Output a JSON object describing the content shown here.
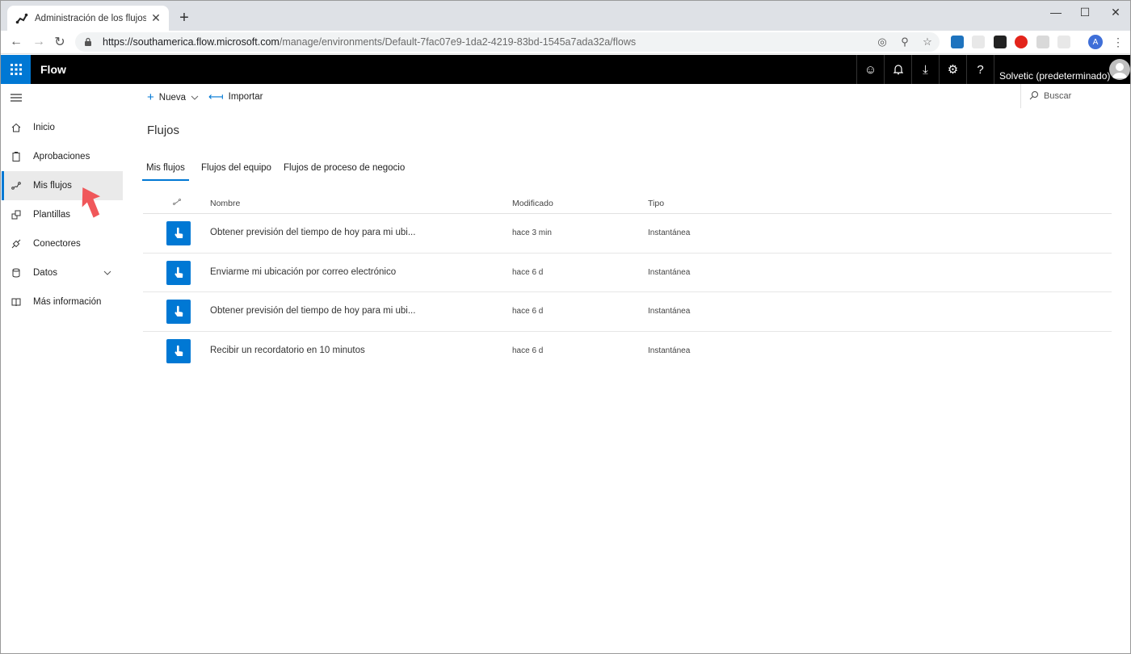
{
  "browser": {
    "tab_title": "Administración de los flujos | Mic",
    "url_host": "https://southamerica.flow.microsoft.com",
    "url_path": "/manage/environments/Default-7fac07e9-1da2-4219-83bd-1545a7ada32a/flows",
    "profile_initial": "A"
  },
  "app": {
    "name": "Flow",
    "environment": "Solvetic (predeterminado)"
  },
  "sidebar": {
    "items": [
      {
        "label": "Inicio",
        "icon": "home-icon"
      },
      {
        "label": "Aprobaciones",
        "icon": "clipboard-icon"
      },
      {
        "label": "Mis flujos",
        "icon": "flow-icon",
        "active": true
      },
      {
        "label": "Plantillas",
        "icon": "templates-icon"
      },
      {
        "label": "Conectores",
        "icon": "connector-icon"
      },
      {
        "label": "Datos",
        "icon": "database-icon",
        "expandable": true
      },
      {
        "label": "Más información",
        "icon": "book-icon"
      }
    ]
  },
  "commands": {
    "new_label": "Nueva",
    "import_label": "Importar",
    "search_label": "Buscar"
  },
  "page": {
    "title": "Flujos",
    "tabs": [
      "Mis flujos",
      "Flujos del equipo",
      "Flujos de proceso de negocio"
    ]
  },
  "table": {
    "columns": [
      "Nombre",
      "Modificado",
      "Tipo"
    ],
    "rows": [
      {
        "name": "Obtener previsión del tiempo de hoy para mi ubi...",
        "modified": "hace 3 min",
        "type": "Instantánea"
      },
      {
        "name": "Enviarme mi ubicación por correo electrónico",
        "modified": "hace 6 d",
        "type": "Instantánea"
      },
      {
        "name": "Obtener previsión del tiempo de hoy para mi ubi...",
        "modified": "hace 6 d",
        "type": "Instantánea"
      },
      {
        "name": "Recibir un recordatorio en 10 minutos",
        "modified": "hace 6 d",
        "type": "Instantánea"
      }
    ]
  },
  "colors": {
    "accent": "#0078d4",
    "appbar": "#000000",
    "pointer": "#f0575a"
  }
}
